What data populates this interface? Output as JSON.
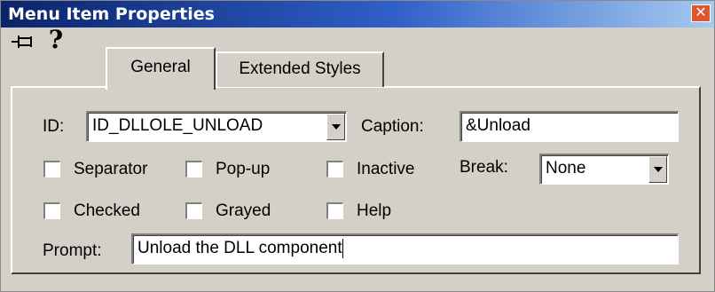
{
  "window": {
    "title": "Menu Item Properties",
    "close_symbol": "✕"
  },
  "toolbar": {
    "pin_icon": "pushpin-icon",
    "help_icon": "question-icon",
    "help_symbol": "?"
  },
  "tabs": [
    {
      "label": "General",
      "active": true
    },
    {
      "label": "Extended Styles",
      "active": false
    }
  ],
  "general": {
    "id_label": "ID:",
    "id_value": "ID_DLLOLE_UNLOAD",
    "caption_label": "Caption:",
    "caption_value": "&Unload",
    "checkboxes": {
      "separator": "Separator",
      "popup": "Pop-up",
      "inactive": "Inactive",
      "checked": "Checked",
      "grayed": "Grayed",
      "help": "Help"
    },
    "break_label": "Break:",
    "break_value": "None",
    "prompt_label": "Prompt:",
    "prompt_value": "Unload the DLL component"
  },
  "colors": {
    "title_start": "#0a246a",
    "title_end": "#a6caf0",
    "face": "#d4d0c8",
    "close": "#e1562c"
  }
}
